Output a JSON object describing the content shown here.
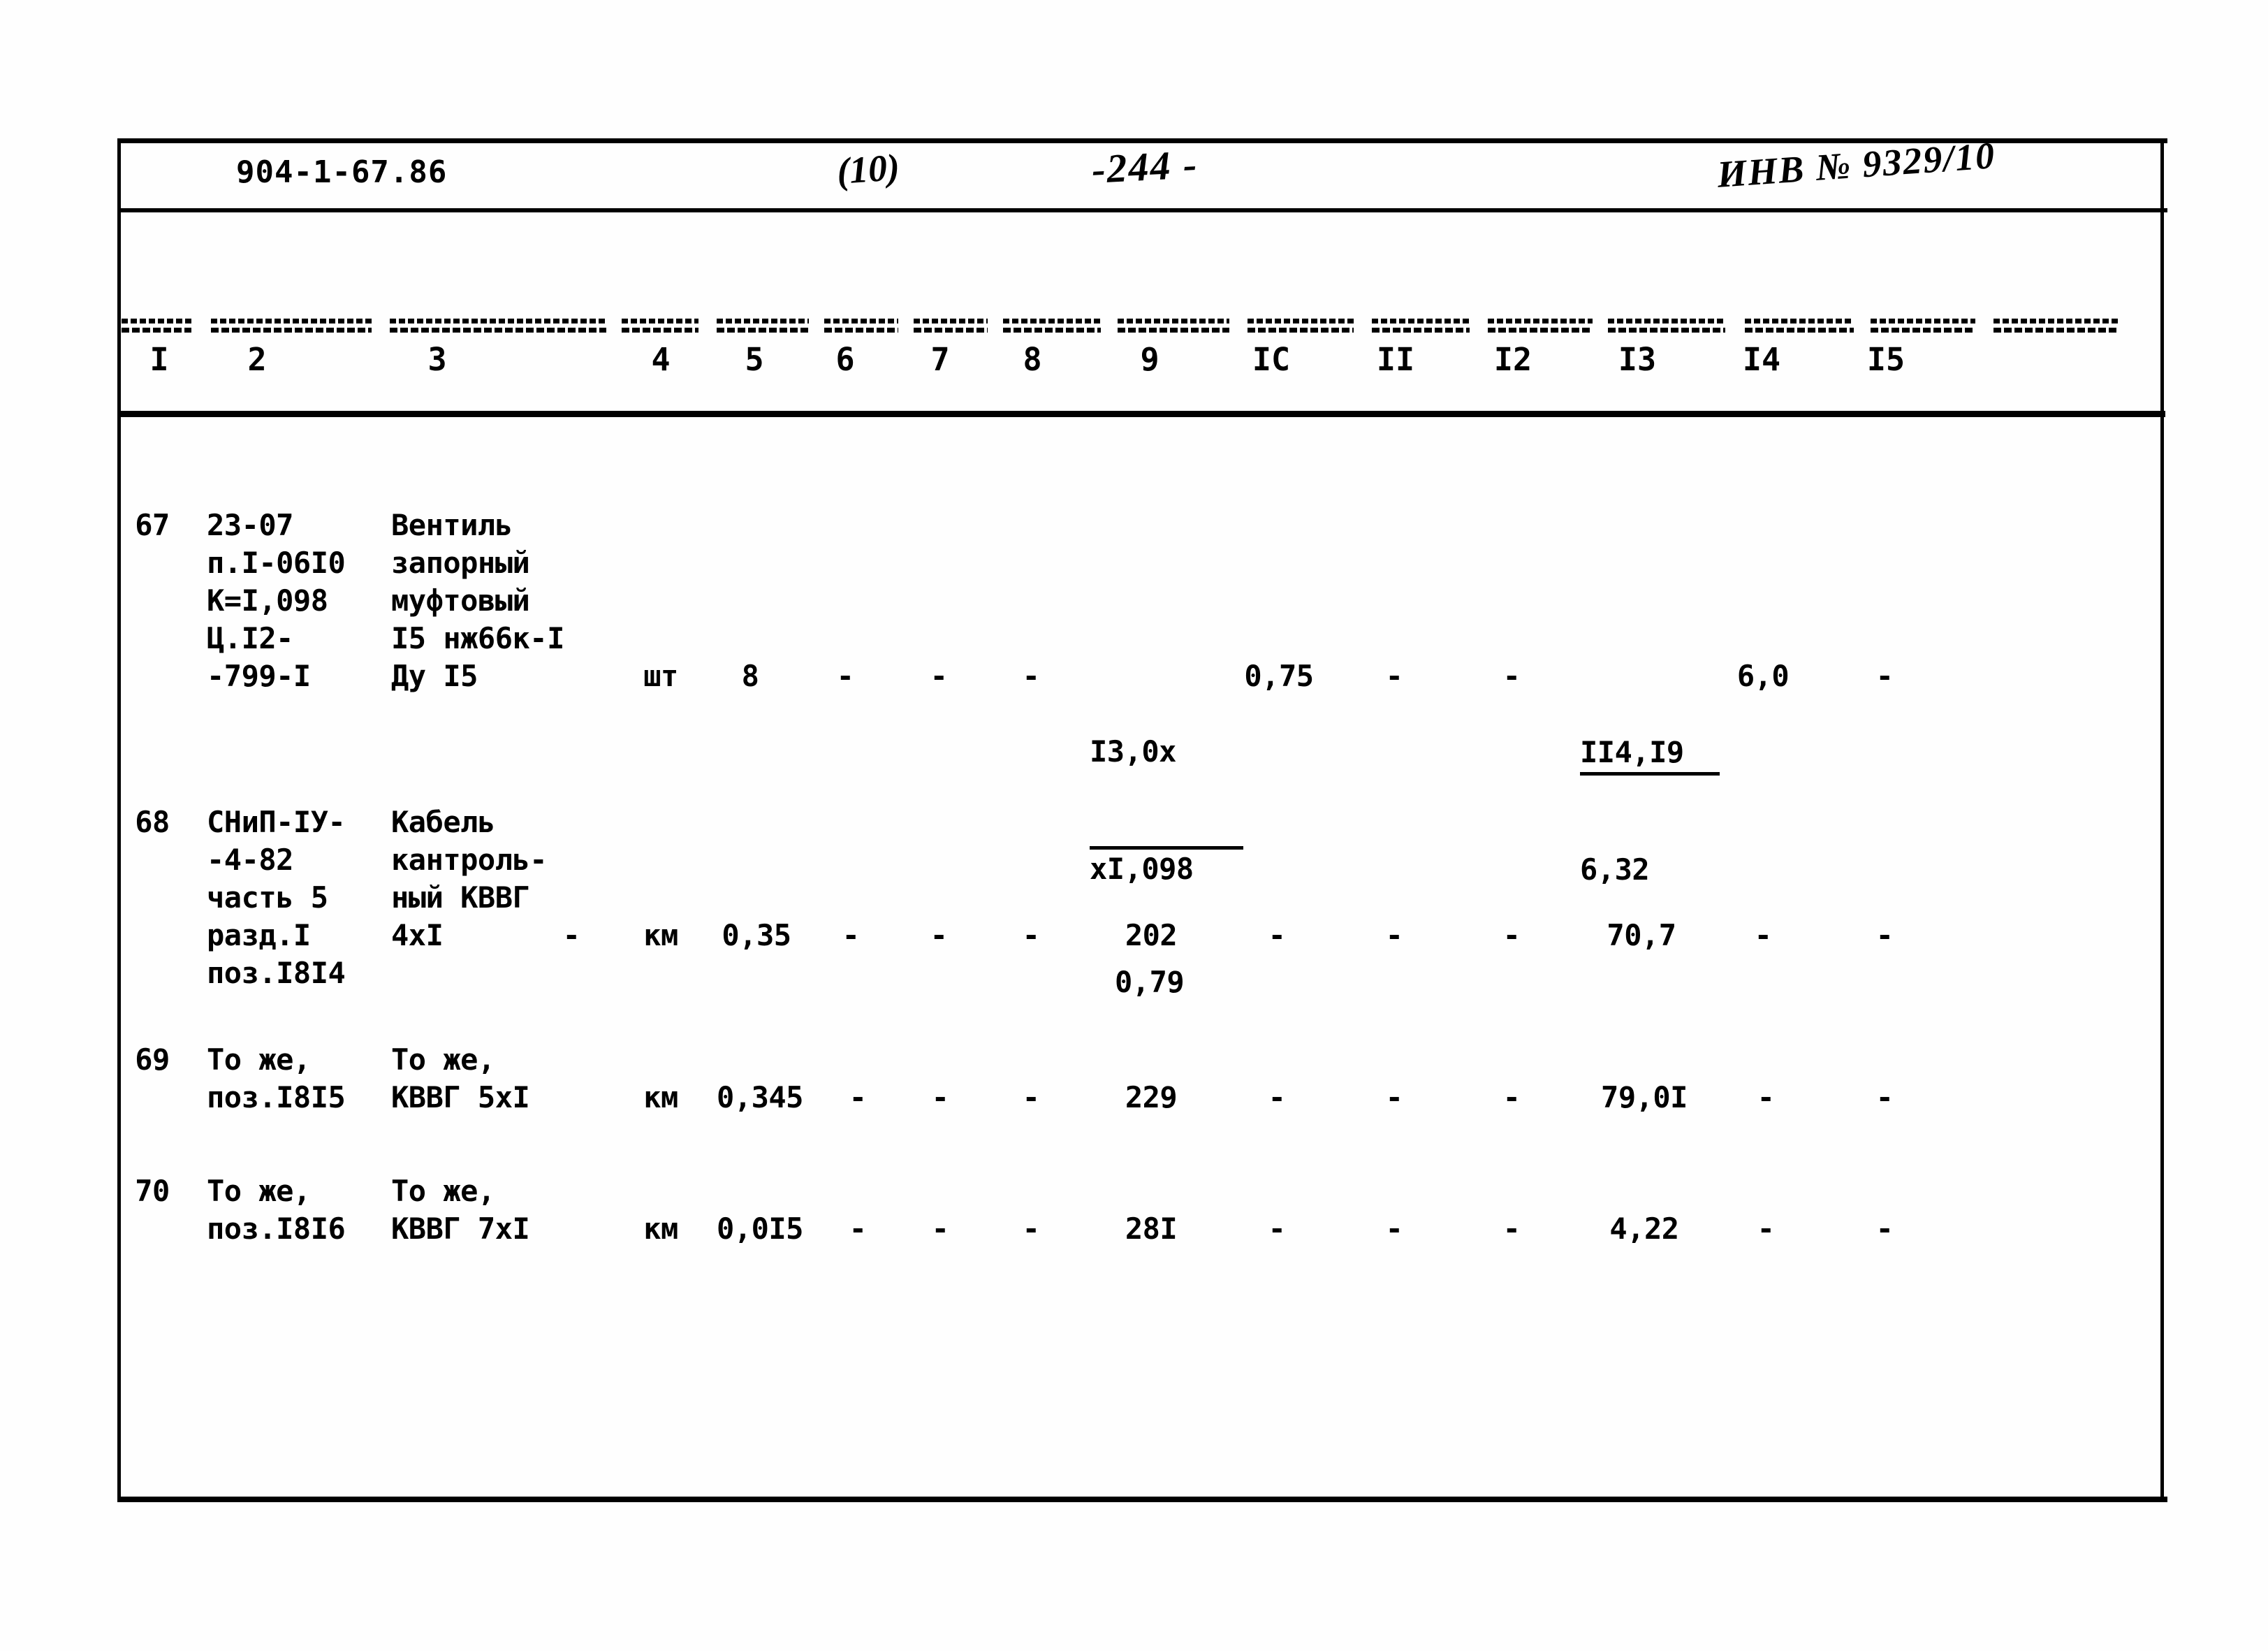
{
  "document": {
    "code": "904-1-67.86",
    "handwritten_page_marker": "(10)",
    "handwritten_page_number": "-244 -",
    "handwritten_inventory": "ИНВ № 9329/10"
  },
  "table": {
    "column_numbers": [
      "I",
      "2",
      "3",
      "4",
      "5",
      "6",
      "7",
      "8",
      "9",
      "IC",
      "II",
      "I2",
      "I3",
      "I4",
      "I5"
    ],
    "rows": [
      {
        "num": "67",
        "code": "23-07\nп.I-06I0\nК=I,098\nЦ.I2-\n-799-I",
        "name": "Вентиль\nзапорный\nмуфтовый\nI5 нж66к-I\nДу I5",
        "unit": "шт",
        "qty": "8",
        "c6": "-",
        "c7": "-",
        "c8": "-",
        "c9_num": "I3,0х",
        "c9_den": "хI,098",
        "c9_res": "0,79",
        "c10": "0,75",
        "c11": "-",
        "c12": "-",
        "c13_num": "II4,I9",
        "c13_res": "6,32",
        "c14": "6,0",
        "c15": "-"
      },
      {
        "num": "68",
        "code": "СНиП-IУ-\n-4-82\nчасть 5\nразд.I\nпоз.I8I4",
        "name": "Кабель\nкантроль-\nный КВВГ\n4хI",
        "dash_after_name": "-",
        "unit": "км",
        "qty": "0,35",
        "c6": "-",
        "c7": "-",
        "c8": "-",
        "c9": "202",
        "c10": "-",
        "c11": "-",
        "c12": "-",
        "c13": "70,7",
        "c14": "-",
        "c15": "-"
      },
      {
        "num": "69",
        "code": "То же,\nпоз.I8I5",
        "name": "То же,\nКВВГ 5хI",
        "unit": "км",
        "qty": "0,345",
        "c6": "-",
        "c7": "-",
        "c8": "-",
        "c9": "229",
        "c10": "-",
        "c11": "-",
        "c12": "-",
        "c13": "79,0I",
        "c14": "-",
        "c15": "-"
      },
      {
        "num": "70",
        "code": "То же,\nпоз.I8I6",
        "name": "То же,\nКВВГ 7хI",
        "unit": "км",
        "qty": "0,0I5",
        "c6": "-",
        "c7": "-",
        "c8": "-",
        "c9": "28I",
        "c10": "-",
        "c11": "-",
        "c12": "-",
        "c13": "4,22",
        "c14": "-",
        "c15": "-"
      }
    ]
  }
}
